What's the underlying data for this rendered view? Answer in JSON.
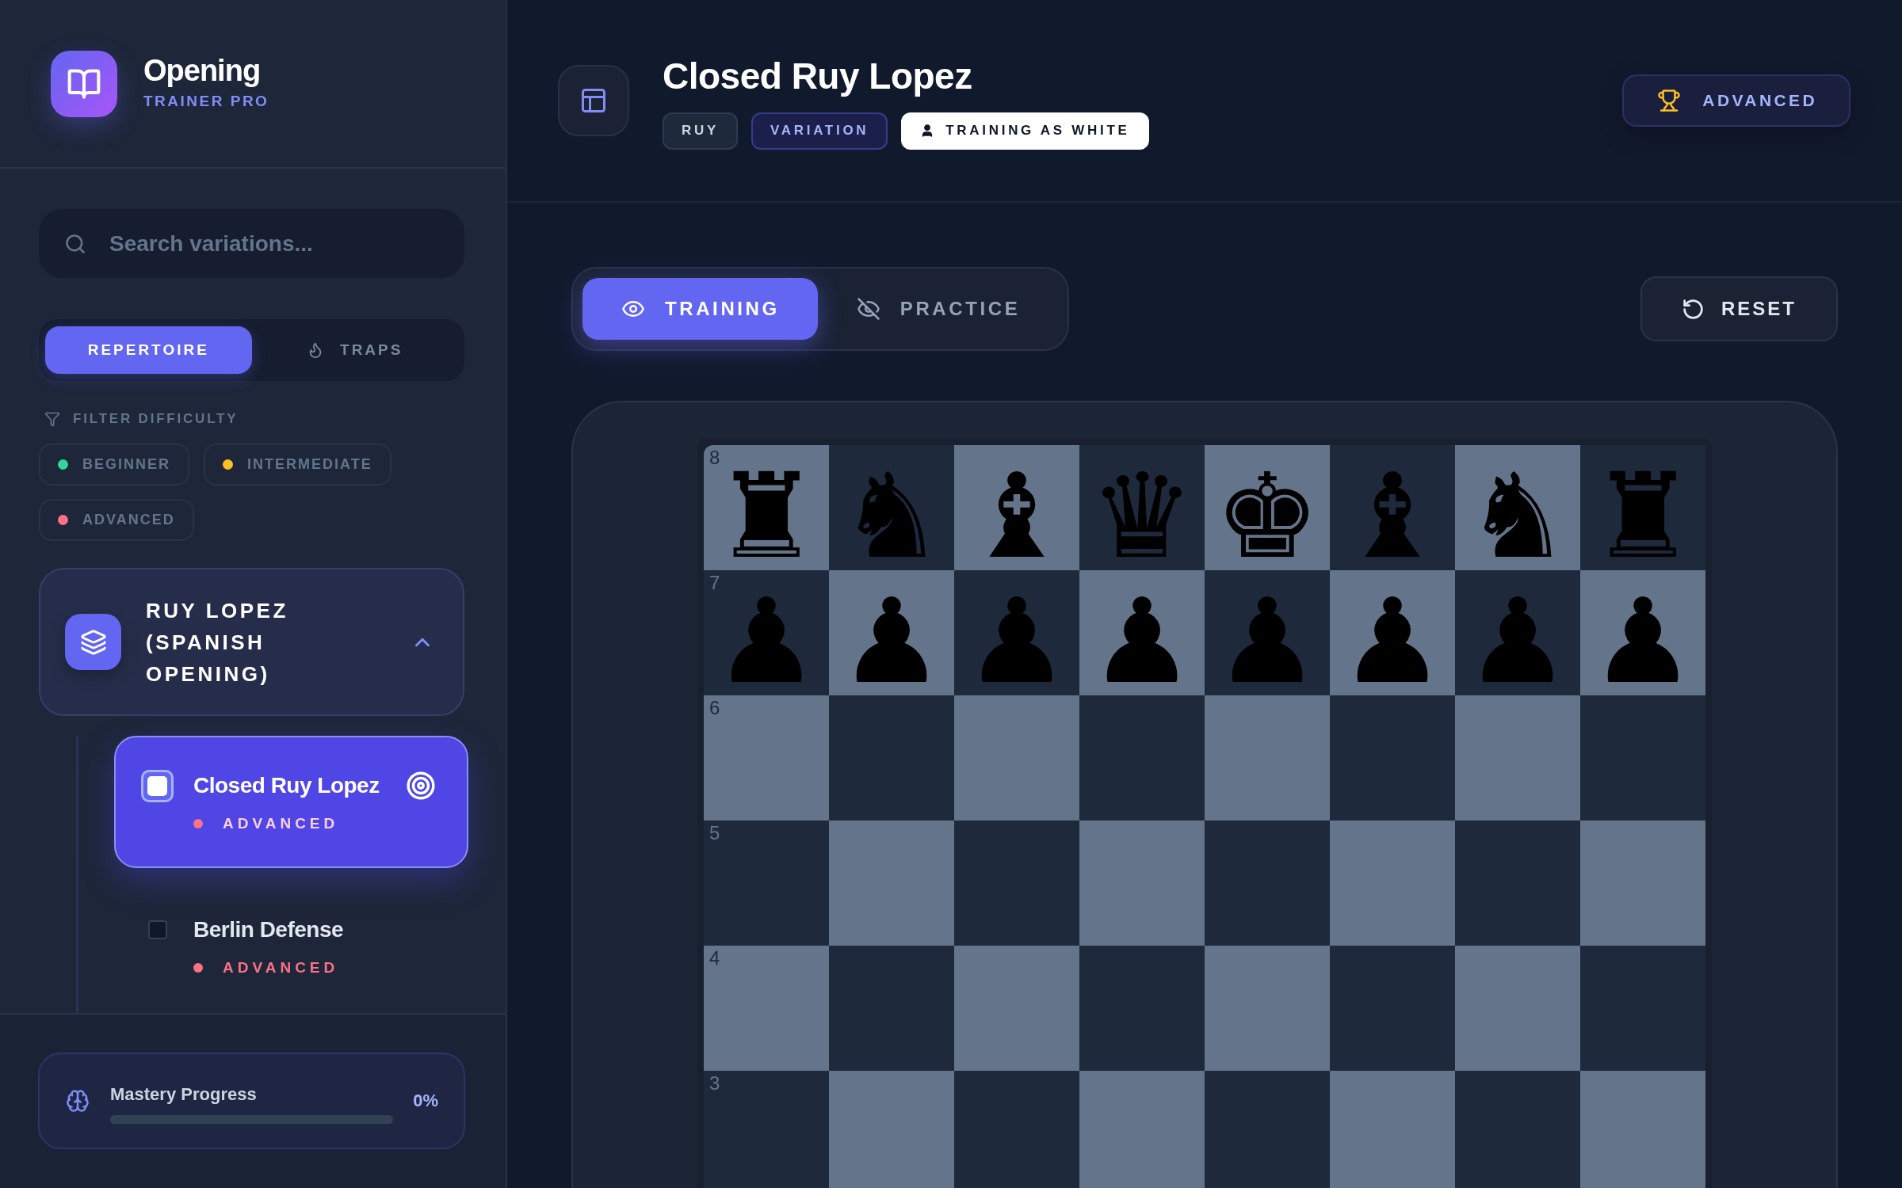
{
  "brand": {
    "title": "Opening",
    "subtitle": "TRAINER PRO"
  },
  "search": {
    "placeholder": "Search variations..."
  },
  "library_tabs": [
    {
      "label": "REPERTOIRE",
      "kind": "plain",
      "selected": true
    },
    {
      "label": "TRAPS",
      "kind": "flame",
      "selected": false
    }
  ],
  "filter": {
    "label": "FILTER DIFFICULTY",
    "chips": [
      {
        "label": "BEGINNER",
        "color": "#34d399"
      },
      {
        "label": "INTERMEDIATE",
        "color": "#fbbf24"
      },
      {
        "label": "ADVANCED",
        "color": "#fb7185"
      }
    ]
  },
  "openings": [
    {
      "title": "RUY LOPEZ (SPANISH OPENING)",
      "expanded": true,
      "children": [
        {
          "name": "Closed Ruy Lopez",
          "difficulty": "ADVANCED",
          "color": "#fb7185",
          "selected": true
        },
        {
          "name": "Berlin Defense",
          "difficulty": "ADVANCED",
          "color": "#fb7185",
          "selected": false
        }
      ]
    }
  ],
  "mastery": {
    "label": "Mastery Progress",
    "reading": "0%"
  },
  "header": {
    "title": "Closed Ruy Lopez",
    "tags": [
      {
        "label": "RUY",
        "kind": "opening"
      },
      {
        "label": "VARIATION",
        "kind": "type"
      },
      {
        "label": "TRAINING AS WHITE",
        "kind": "side"
      }
    ],
    "difficulty_badge": "ADVANCED"
  },
  "view_modes": [
    {
      "label": "TRAINING",
      "kind": "visible",
      "selected": true
    },
    {
      "label": "PRACTICE",
      "kind": "hidden",
      "selected": false
    }
  ],
  "reset_button": "RESET",
  "board": {
    "ranks": [
      {
        "label": "8",
        "pieces": [
          "♜",
          "♞",
          "♝",
          "♛",
          "♚",
          "♝",
          "♞",
          "♜"
        ]
      },
      {
        "label": "7",
        "pieces": [
          "♟",
          "♟",
          "♟",
          "♟",
          "♟",
          "♟",
          "♟",
          "♟"
        ]
      },
      {
        "label": "6"
      },
      {
        "label": "5"
      },
      {
        "label": "4"
      },
      {
        "label": "3"
      }
    ]
  }
}
